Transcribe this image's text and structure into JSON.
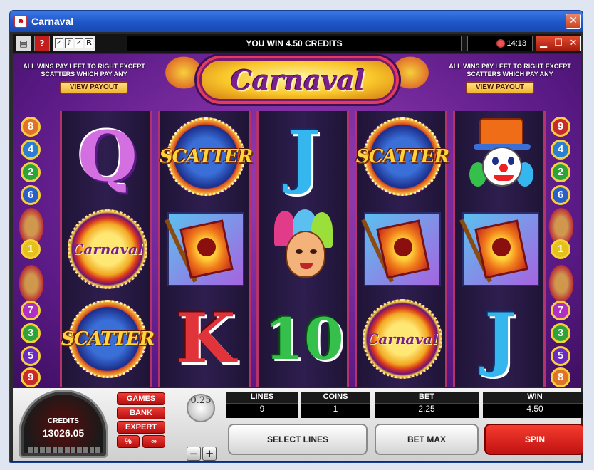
{
  "window": {
    "title": "Carnaval",
    "close": "✕"
  },
  "gamebar": {
    "message": "YOU WIN 4.50 CREDITS",
    "time": "14:13",
    "buttons": [
      "▤",
      "?"
    ],
    "window_controls": [
      "▁",
      "☐",
      "✕"
    ]
  },
  "header": {
    "logo": "Carnaval",
    "rule_left": "ALL WINS PAY LEFT TO RIGHT EXCEPT SCATTERS WHICH PAY ANY",
    "rule_right": "ALL WINS PAY LEFT TO RIGHT EXCEPT SCATTERS WHICH PAY ANY",
    "view_payout_left": "VIEW PAYOUT",
    "view_payout_right": "VIEW PAYOUT"
  },
  "lines_left": [
    {
      "num": "8",
      "color": "#e0722a"
    },
    {
      "num": "4",
      "color": "#2a7ed6"
    },
    {
      "num": "2",
      "color": "#2fa33a"
    },
    {
      "num": "6",
      "color": "#2a5fc9"
    },
    {
      "num": "1",
      "color": "#e3c21b"
    },
    {
      "num": "7",
      "color": "#b02fc4"
    },
    {
      "num": "3",
      "color": "#2fa33a"
    },
    {
      "num": "5",
      "color": "#6a2ac4"
    },
    {
      "num": "9",
      "color": "#c92a2a"
    }
  ],
  "lines_right": [
    {
      "num": "9",
      "color": "#c92a2a"
    },
    {
      "num": "4",
      "color": "#2a7ed6"
    },
    {
      "num": "2",
      "color": "#2fa33a"
    },
    {
      "num": "6",
      "color": "#2a5fc9"
    },
    {
      "num": "1",
      "color": "#e3c21b"
    },
    {
      "num": "7",
      "color": "#b02fc4"
    },
    {
      "num": "3",
      "color": "#2fa33a"
    },
    {
      "num": "5",
      "color": "#6a2ac4"
    },
    {
      "num": "8",
      "color": "#e0722a"
    }
  ],
  "reels": {
    "r1": [
      "Q",
      "Carnaval",
      "SCATTER"
    ],
    "r2": [
      "SCATTER",
      "flag",
      "K"
    ],
    "r3": [
      "J",
      "dancer",
      "10"
    ],
    "r4": [
      "SCATTER",
      "flag",
      "Carnaval"
    ],
    "r5": [
      "clown",
      "flag",
      "J"
    ]
  },
  "panel": {
    "credits_label": "CREDITS",
    "credits_value": "13026.05",
    "menu": {
      "games": "GAMES",
      "bank": "BANK",
      "expert": "EXPERT",
      "percent": "%",
      "infinity": "∞"
    },
    "coin_size": "0.25",
    "minus": "−",
    "plus": "+",
    "lines_label": "LINES",
    "lines_value": "9",
    "coins_label": "COINS",
    "coins_value": "1",
    "bet_label": "BET",
    "bet_value": "2.25",
    "win_label": "WIN",
    "win_value": "4.50",
    "select_lines": "SELECT LINES",
    "bet_max": "BET MAX",
    "spin": "SPIN"
  }
}
